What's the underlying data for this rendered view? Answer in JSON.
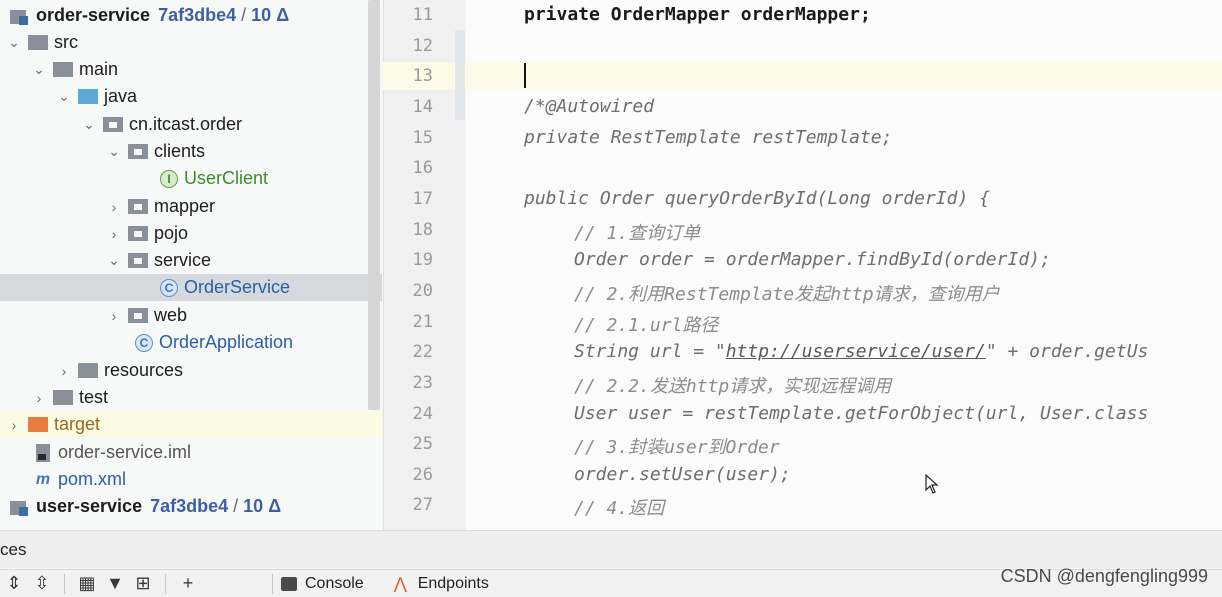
{
  "tree": {
    "order_module": {
      "name": "order-service",
      "hash": "7af3dbe4",
      "changes": "10 Δ"
    },
    "items": [
      {
        "name": "src"
      },
      {
        "name": "main"
      },
      {
        "name": "java"
      },
      {
        "name": "cn.itcast.order"
      },
      {
        "name": "clients"
      },
      {
        "name": "UserClient"
      },
      {
        "name": "mapper"
      },
      {
        "name": "pojo"
      },
      {
        "name": "service"
      },
      {
        "name": "OrderService"
      },
      {
        "name": "web"
      },
      {
        "name": "OrderApplication"
      },
      {
        "name": "resources"
      },
      {
        "name": "test"
      },
      {
        "name": "target"
      },
      {
        "name": "order-service.iml"
      },
      {
        "name": "pom.xml"
      }
    ],
    "user_module": {
      "name": "user-service",
      "hash": "7af3dbe4",
      "changes": "10 Δ"
    }
  },
  "editor": {
    "line_numbers": [
      "11",
      "12",
      "13",
      "14",
      "15",
      "16",
      "17",
      "18",
      "19",
      "20",
      "21",
      "22",
      "23",
      "24",
      "25",
      "26",
      "27"
    ],
    "lines": {
      "l11": "private OrderMapper orderMapper;",
      "l14": "/*@Autowired",
      "l15": "private RestTemplate restTemplate;",
      "l17": "public Order queryOrderById(Long orderId) {",
      "l18": "// 1.查询订单",
      "l19": "Order order = orderMapper.findById(orderId);",
      "l20": "// 2.利用RestTemplate发起http请求，查询用户",
      "l21": "// 2.1.url路径",
      "l22_pre": "String url = \"",
      "l22_url": "http://userservice/user/",
      "l22_post": "\" + order.getUs",
      "l23": "// 2.2.发送http请求，实现远程调用",
      "l24": "User user = restTemplate.getForObject(url, User.class",
      "l25": "// 3.封装user到Order",
      "l26": "order.setUser(user);",
      "l27": "// 4.返回"
    }
  },
  "bottom": {
    "panel_label": "ces",
    "tabs": {
      "console": "Console",
      "endpoints": "Endpoints"
    }
  },
  "watermark": "CSDN @dengfengling999"
}
